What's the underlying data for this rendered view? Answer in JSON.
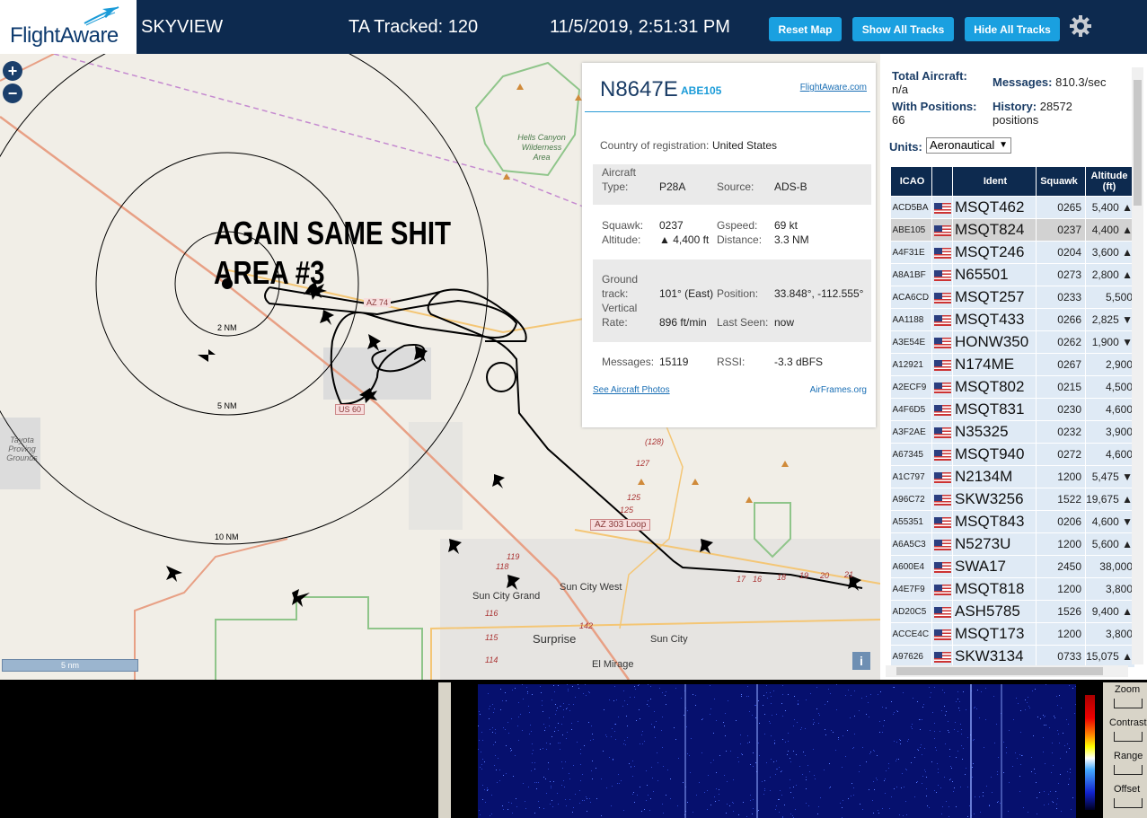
{
  "header": {
    "logo": "FlightAware",
    "app_title": "SKYVIEW",
    "tracked_label": "TA Tracked: 120",
    "datetime": "11/5/2019, 2:51:31 PM",
    "reset_map": "Reset Map",
    "show_all_tracks": "Show All Tracks",
    "hide_all_tracks": "Hide All Tracks",
    "settings_icon": "gear-icon"
  },
  "map": {
    "annotation_line1": "AGAIN SAME SHIT",
    "annotation_line2": "AREA #3",
    "zoom_in": "+",
    "zoom_out": "−",
    "scale_bar": "5 nm",
    "info": "i",
    "range_rings": [
      "2 NM",
      "5 NM",
      "10 NM"
    ],
    "place_labels": {
      "hells_canyon": "Hells Canyon",
      "wilderness": "Wilderness",
      "area": "Area",
      "tayota": "Tayota",
      "proving": "Proving",
      "grounds": "Grounds",
      "sun_city_grand": "Sun City Grand",
      "sun_city_west": "Sun City West",
      "surprise": "Surprise",
      "sun_city": "Sun City",
      "el_mirage": "El Mirage"
    },
    "road_labels": {
      "az74": "AZ 74",
      "us60": "US 60",
      "az303": "AZ 303 Loop",
      "r128": "(128)",
      "r127": "127",
      "r125a": "125",
      "r125b": "125",
      "r119": "119",
      "r118": "118",
      "r116": "116",
      "r115": "115",
      "r114": "114",
      "r142": "142",
      "r17": "17",
      "r16": "16",
      "r18": "18",
      "r19": "19",
      "r20": "20",
      "r21": "21"
    }
  },
  "popup": {
    "registration": "N8647E",
    "callsign": "ABE105",
    "fa_link": "FlightAware.com",
    "country_label": "Country of registration:",
    "country": "United States",
    "aircraft_type_label1": "Aircraft",
    "aircraft_type_label2": "Type:",
    "aircraft_type": "P28A",
    "source_label": "Source:",
    "source": "ADS-B",
    "squawk_label": "Squawk:",
    "squawk": "0237",
    "gspeed_label": "Gspeed:",
    "gspeed": "69 kt",
    "altitude_label": "Altitude:",
    "altitude": "▲ 4,400 ft",
    "distance_label": "Distance:",
    "distance": "3.3 NM",
    "track_label1": "Ground",
    "track_label2": "track:",
    "track": "101° (East)",
    "position_label": "Position:",
    "position": "33.848°, -112.555°",
    "vrate_label1": "Vertical",
    "vrate_label2": "Rate:",
    "vrate": "896 ft/min",
    "lastseen_label": "Last Seen:",
    "lastseen": "now",
    "messages_label": "Messages:",
    "messages": "15119",
    "rssi_label": "RSSI:",
    "rssi": "-3.3 dBFS",
    "photos_link": "See Aircraft Photos",
    "airframes_link": "AirFrames.org"
  },
  "stats": {
    "total_label": "Total Aircraft:",
    "total_value": "n/a",
    "messages_label": "Messages:",
    "messages_value": "810.3/sec",
    "positions_label": "With Positions:",
    "positions_value": "66",
    "history_label": "History:",
    "history_value": "28572",
    "history_unit": "positions",
    "units_label": "Units:",
    "units_value": "Aeronautical"
  },
  "table": {
    "headers": {
      "icao": "ICAO",
      "ident": "Ident",
      "squawk": "Squawk",
      "altitude": "Altitude (ft)"
    },
    "rows": [
      {
        "icao": "ACD5BA",
        "ident": "MSQT462",
        "squawk": "0265",
        "alt": "5,400 ▲"
      },
      {
        "icao": "ABE105",
        "ident": "MSQT824",
        "squawk": "0237",
        "alt": "4,400 ▲"
      },
      {
        "icao": "A4F31E",
        "ident": "MSQT246",
        "squawk": "0204",
        "alt": "3,600 ▲"
      },
      {
        "icao": "A8A1BF",
        "ident": "N65501",
        "squawk": "0273",
        "alt": "2,800 ▲"
      },
      {
        "icao": "ACA6CD",
        "ident": "MSQT257",
        "squawk": "0233",
        "alt": "5,500"
      },
      {
        "icao": "AA1188",
        "ident": "MSQT433",
        "squawk": "0266",
        "alt": "2,825 ▼"
      },
      {
        "icao": "A3E54E",
        "ident": "HONW350",
        "squawk": "0262",
        "alt": "1,900 ▼"
      },
      {
        "icao": "A12921",
        "ident": "N174ME",
        "squawk": "0267",
        "alt": "2,900"
      },
      {
        "icao": "A2ECF9",
        "ident": "MSQT802",
        "squawk": "0215",
        "alt": "4,500"
      },
      {
        "icao": "A4F6D5",
        "ident": "MSQT831",
        "squawk": "0230",
        "alt": "4,600"
      },
      {
        "icao": "A3F2AE",
        "ident": "N35325",
        "squawk": "0232",
        "alt": "3,900"
      },
      {
        "icao": "A67345",
        "ident": "MSQT940",
        "squawk": "0272",
        "alt": "4,600"
      },
      {
        "icao": "A1C797",
        "ident": "N2134M",
        "squawk": "1200",
        "alt": "5,475 ▼"
      },
      {
        "icao": "A96C72",
        "ident": "SKW3256",
        "squawk": "1522",
        "alt": "19,675 ▲"
      },
      {
        "icao": "A55351",
        "ident": "MSQT843",
        "squawk": "0206",
        "alt": "4,600 ▼"
      },
      {
        "icao": "A6A5C3",
        "ident": "N5273U",
        "squawk": "1200",
        "alt": "5,600 ▲"
      },
      {
        "icao": "A600E4",
        "ident": "SWA17",
        "squawk": "2450",
        "alt": "38,000"
      },
      {
        "icao": "A4E7F9",
        "ident": "MSQT818",
        "squawk": "1200",
        "alt": "3,800"
      },
      {
        "icao": "AD20C5",
        "ident": "ASH5785",
        "squawk": "1526",
        "alt": "9,400 ▲"
      },
      {
        "icao": "ACCE4C",
        "ident": "MSQT173",
        "squawk": "1200",
        "alt": "3,800"
      },
      {
        "icao": "A97626",
        "ident": "SKW3134",
        "squawk": "0733",
        "alt": "15,075 ▲"
      }
    ],
    "selected_index": 1
  },
  "waterfall": {
    "zoom_label": "Zoom",
    "contrast_label": "Contrast",
    "range_label": "Range",
    "offset_label": "Offset"
  },
  "colors": {
    "header_bg": "#0d2a4f",
    "button": "#1aa0e0",
    "accent": "#1a9bd8",
    "map_bg": "#f1eee7",
    "table_row": "#dfeaf5",
    "spectrogram": "#06106e"
  }
}
